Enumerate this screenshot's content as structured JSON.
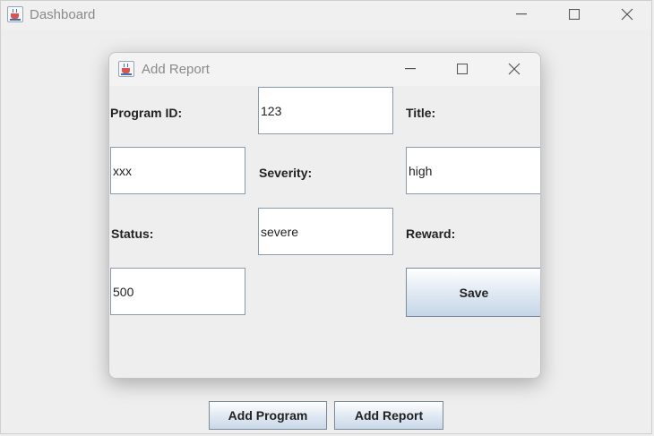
{
  "main_window": {
    "title": "Dashboard",
    "buttons": {
      "add_program": "Add Program",
      "add_report": "Add Report"
    }
  },
  "dialog": {
    "title": "Add Report",
    "fields": {
      "program_id": {
        "label": "Program ID:",
        "value": "123"
      },
      "title": {
        "label": "Title:",
        "value": "xxx"
      },
      "severity": {
        "label": "Severity:",
        "value": "high"
      },
      "status": {
        "label": "Status:",
        "value": "severe"
      },
      "reward": {
        "label": "Reward:",
        "value": "500"
      }
    },
    "save_label": "Save"
  },
  "icons": {
    "app": "java-cup-icon",
    "minimize": "minimize-icon",
    "maximize": "maximize-icon",
    "close": "close-icon"
  },
  "colors": {
    "window_bg": "#eeeeee",
    "field_border": "#8b9aab",
    "button_gradient_bottom": "#c9d8e8",
    "title_text": "#8a8a8a"
  }
}
